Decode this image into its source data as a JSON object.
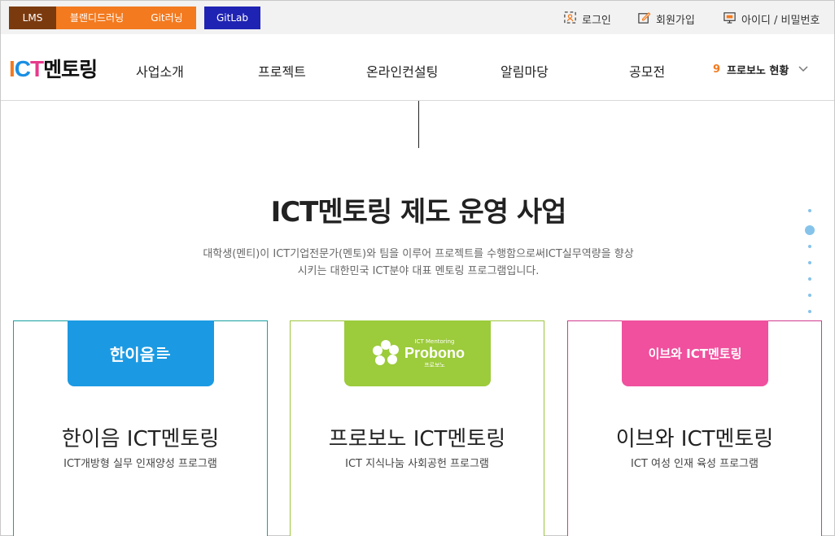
{
  "topbar": {
    "lms": "LMS",
    "blended": "블랜디드러닝",
    "git": "Git러닝",
    "gitlab": "GitLab",
    "login": "로그인",
    "join": "회원가입",
    "find": "아이디 / 비밀번호"
  },
  "header": {
    "logo_i": "I",
    "logo_c": "C",
    "logo_t": "T",
    "logo_kr": "멘토링",
    "nav": [
      "사업소개",
      "프로젝트",
      "온라인컨설팅",
      "알림마당",
      "공모전"
    ],
    "status_num": "9",
    "status_label": "프로보노 현황"
  },
  "main": {
    "title": "ICT멘토링 제도 운영 사업",
    "desc_line1": "대학생(멘티)이 ICT기업전문가(멘토)와 팀을 이루어 프로젝트를 수행함으로써ICT실무역량을 향상",
    "desc_line2": "시키는 대한민국 ICT분야 대표 멘토링 프로그램입니다."
  },
  "cards": [
    {
      "badge": "한이음",
      "name": "한이음 ICT멘토링",
      "sub": "ICT개방형 실무 인재양성 프로그램"
    },
    {
      "badge": "Probono",
      "badge_top": "ICT Mentoring",
      "badge_bottom": "프로보노",
      "name": "프로보노 ICT멘토링",
      "sub": "ICT 지식나눔 사회공헌 프로그램"
    },
    {
      "badge": "이브와 ICT멘토링",
      "name": "이브와 ICT멘토링",
      "sub": "ICT 여성 인재 육성 프로그램"
    }
  ],
  "colors": {
    "orange": "#f37a1f",
    "blue": "#1b9ae3",
    "green": "#9ccb3b",
    "pink": "#f0509e",
    "gitlab": "#1f23b3"
  }
}
